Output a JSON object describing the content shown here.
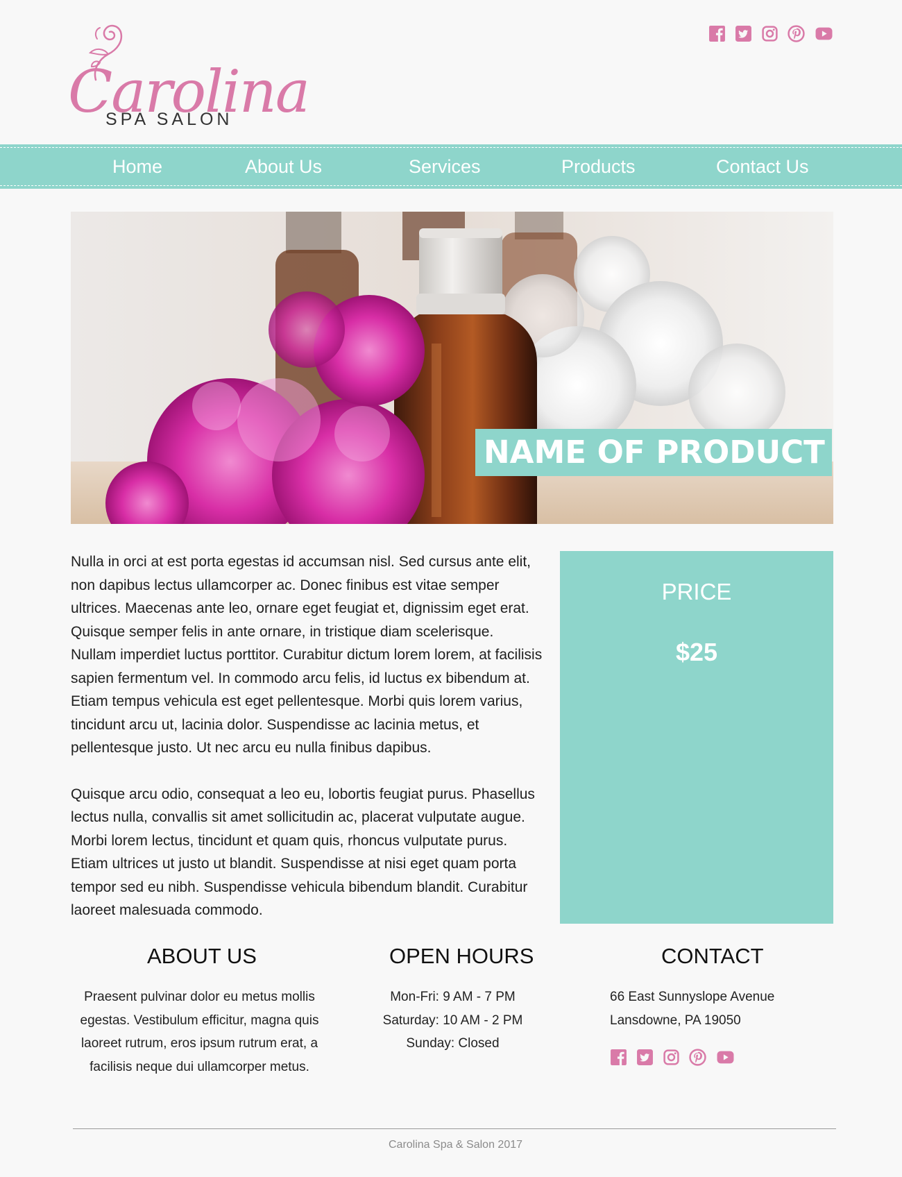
{
  "brand": {
    "script_name": "Carolina",
    "subtitle": "SPA SALON",
    "accent_color": "#d97aa8",
    "teal_color": "#8ed5cb"
  },
  "social_icons": [
    "facebook-icon",
    "twitter-icon",
    "instagram-icon",
    "pinterest-icon",
    "youtube-icon"
  ],
  "nav": {
    "items": [
      {
        "label": "Home"
      },
      {
        "label": "About Us"
      },
      {
        "label": "Services"
      },
      {
        "label": "Products"
      },
      {
        "label": "Contact Us"
      }
    ]
  },
  "hero": {
    "product_name": "NAME OF PRODUCT"
  },
  "description": {
    "paragraphs": [
      "Nulla in orci at est porta egestas id accumsan nisl. Sed cursus ante elit, non dapibus lectus ullamcorper ac. Donec finibus est vitae semper ultrices. Maecenas ante leo, ornare eget feugiat et, dignissim eget erat. Quisque semper felis in ante ornare, in tristique diam scelerisque. Nullam imperdiet luctus porttitor. Curabitur dictum lorem lorem, at facilisis sapien fermentum vel. In commodo arcu felis, id luctus ex bibendum at. Etiam tempus vehicula est eget pellentesque. Morbi quis lorem varius, tincidunt arcu ut, lacinia dolor. Suspendisse ac lacinia metus, et pellentesque justo. Ut nec arcu eu nulla finibus dapibus.",
      "Quisque arcu odio, consequat a leo eu, lobortis feugiat purus. Phasellus lectus nulla, convallis sit amet sollicitudin ac, placerat vulputate augue. Morbi lorem lectus, tincidunt et quam quis, rhoncus vulputate purus. Etiam ultrices ut justo ut blandit. Suspendisse at nisi eget quam porta tempor sed eu nibh. Suspendisse vehicula bibendum blandit. Curabitur laoreet malesuada commodo."
    ]
  },
  "price": {
    "label": "PRICE",
    "value": "$25"
  },
  "footer": {
    "about": {
      "title": "ABOUT US",
      "text": "Praesent pulvinar dolor eu metus mollis egestas. Vestibulum efficitur, magna quis laoreet rutrum, eros ipsum rutrum erat, a facilisis neque dui ullamcorper metus."
    },
    "hours": {
      "title": "OPEN HOURS",
      "lines": [
        "Mon-Fri: 9 AM - 7 PM",
        "Saturday: 10 AM - 2 PM",
        "Sunday: Closed"
      ]
    },
    "contact": {
      "title": "CONTACT",
      "address_line1": "66 East Sunnyslope Avenue",
      "address_line2": "Lansdowne, PA 19050"
    },
    "copyright": "Carolina Spa & Salon 2017"
  }
}
